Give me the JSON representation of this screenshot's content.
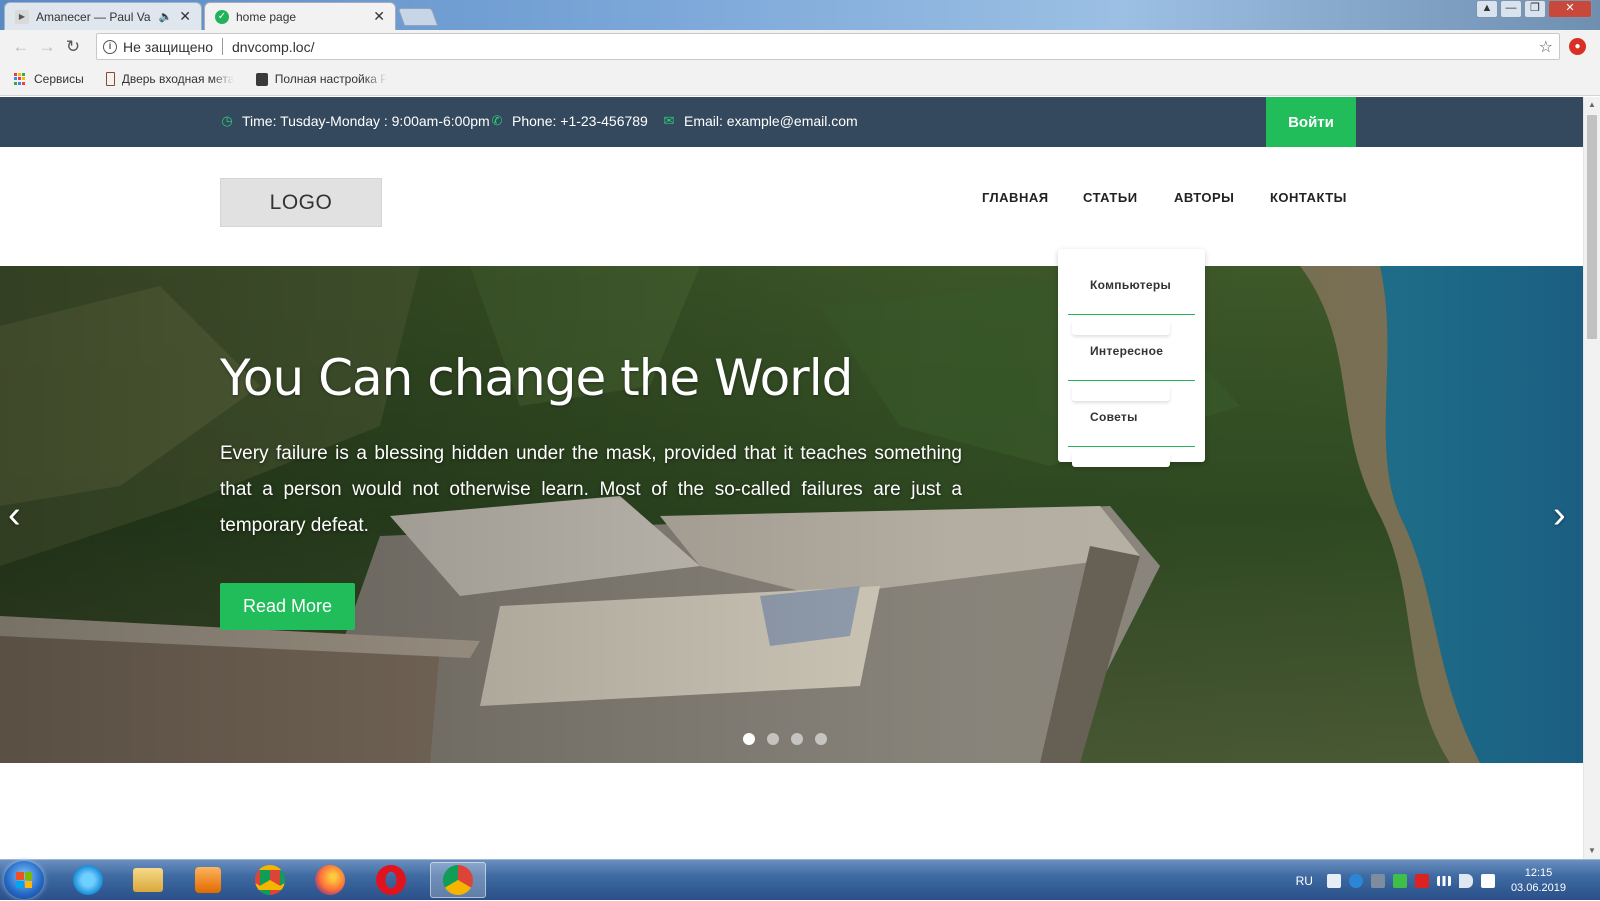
{
  "browser": {
    "tabs": [
      {
        "title": "Amanecer — Paul Va",
        "audio": "speaker-icon",
        "close": "✕"
      },
      {
        "title": "home page",
        "close": "✕"
      }
    ],
    "nav": {
      "back": "←",
      "forward": "→",
      "reload": "↻"
    },
    "omnibox": {
      "security": "Не защищено",
      "url": "dnvcomp.loc/"
    },
    "bookmarks": [
      {
        "label": "Сервисы",
        "icon": "apps-icon"
      },
      {
        "label": "Дверь входная мета",
        "icon": "door-icon"
      },
      {
        "label": "Полная настройка Р",
        "icon": "doc-icon"
      }
    ],
    "window_controls": [
      "▲",
      "—",
      "❐",
      "✕"
    ]
  },
  "page": {
    "topbar": {
      "time": "Time: Tusday-Monday : 9:00am-6:00pm",
      "phone": "Phone: +1-23-456789",
      "email": "Email: example@email.com",
      "login": "Войти"
    },
    "logo": "LOGO",
    "menu": [
      "ГЛАВНАЯ",
      "СТАТЬИ",
      "АВТОРЫ",
      "КОНТАКТЫ"
    ],
    "dropdown": [
      "Компьютеры",
      "Интересное",
      "Советы"
    ],
    "hero": {
      "title": "You Can change the World",
      "text": "Every failure is a blessing hidden under the mask, provided that it teaches something that a person would not otherwise learn. Most of the so-called failures are just a temporary defeat.",
      "button": "Read More",
      "slides": 4,
      "active_slide": 1
    }
  },
  "taskbar": {
    "apps": [
      "internet-explorer-icon",
      "file-explorer-icon",
      "media-player-icon",
      "chrome-icon",
      "firefox-icon",
      "opera-icon",
      "chrome-icon"
    ],
    "lang": "RU",
    "time": "12:15",
    "date": "03.06.2019"
  },
  "colors": {
    "accent": "#22bd5b",
    "topbar": "#34495e"
  }
}
